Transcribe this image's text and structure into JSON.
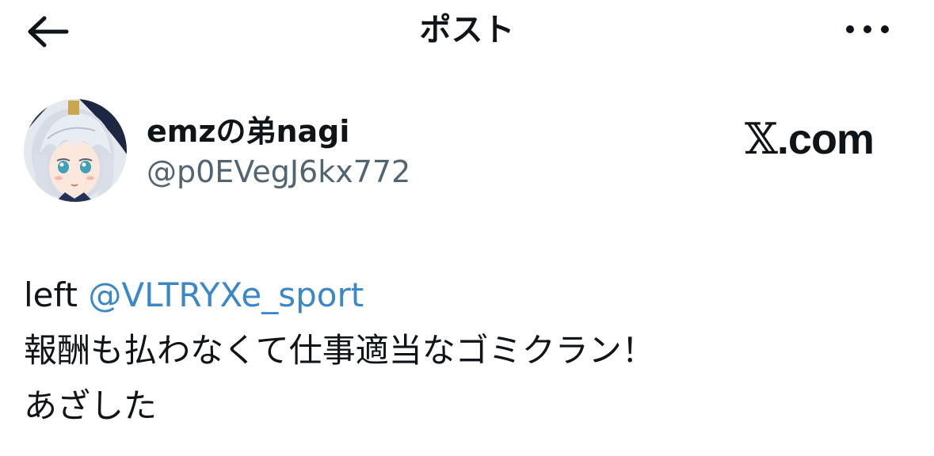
{
  "header": {
    "title": "ポスト",
    "back_icon": "arrow-left-icon",
    "more_icon": "more-horizontal-icon"
  },
  "author": {
    "display_name": "emzの弟nagi",
    "handle": "@p0EVegJ6kx772",
    "avatar": "anime-avatar"
  },
  "brand": {
    "x_letter": "𝕏",
    "domain": ".com"
  },
  "post": {
    "line1_prefix": "left ",
    "mention": "@VLTRYXe_sport",
    "line2": "報酬も払わなくて仕事適当なゴミクラン！",
    "line3": "あざした"
  },
  "colors": {
    "text": "#0f1419",
    "secondary": "#536471",
    "link": "#3b87c7"
  }
}
